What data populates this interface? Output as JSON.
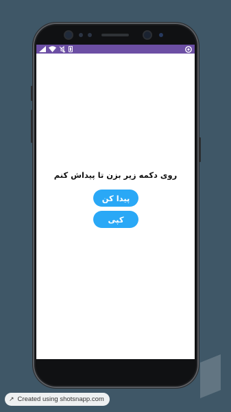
{
  "screen": {
    "prompt": "روی دکمه زیر بزن تا پیداش کنم",
    "find_button_label": "پیدا کن",
    "copy_button_label": "کپی"
  },
  "colors": {
    "background": "#3f5767",
    "status_bar": "#6c4fa4",
    "button": "#2aa8f6"
  },
  "footer": {
    "label": "Created using shotsnapp.com",
    "icon": "arrow-up-right-icon"
  },
  "status_bar": {
    "icons": [
      "signal-icon",
      "wifi-icon",
      "mute-icon",
      "battery-icon",
      "app-icon"
    ]
  }
}
